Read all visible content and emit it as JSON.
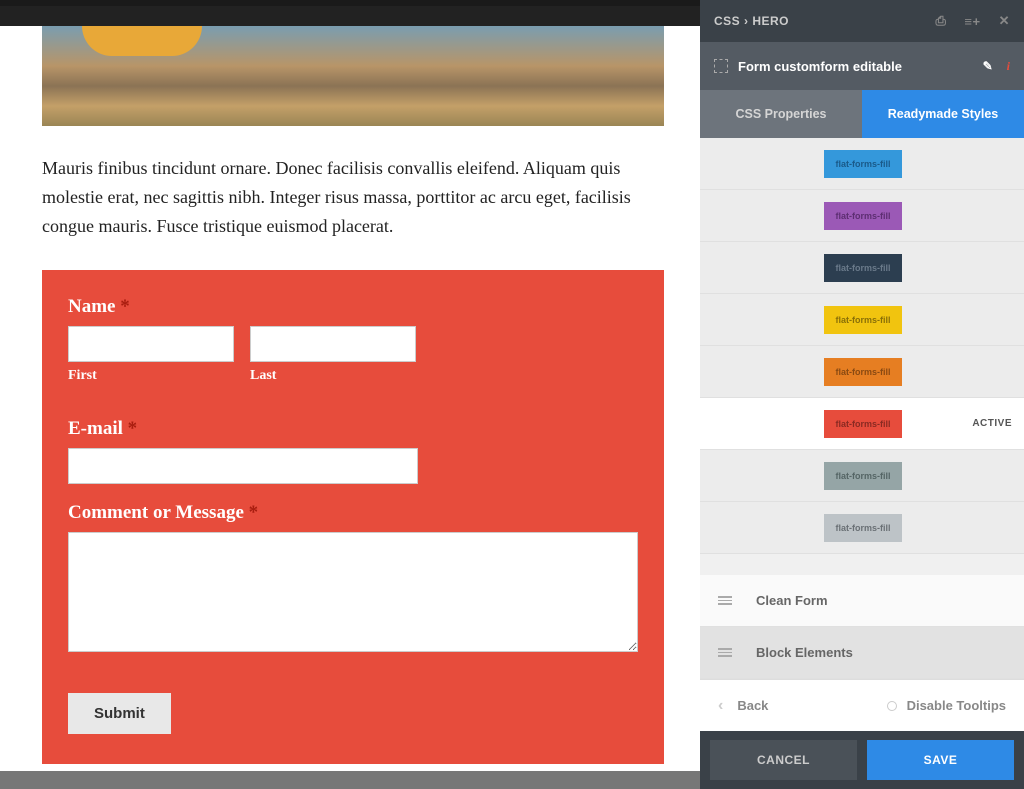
{
  "page": {
    "body_text": "Mauris finibus tincidunt ornare. Donec facilisis convallis eleifend. Aliquam quis molestie erat, nec sagittis nibh. Integer risus massa, porttitor ac arcu eget, facilisis congue mauris. Fusce tristique euismod placerat."
  },
  "form": {
    "name_label": "Name",
    "first_label": "First",
    "last_label": "Last",
    "email_label": "E-mail",
    "message_label": "Comment or Message",
    "required_mark": "*",
    "submit_label": "Submit"
  },
  "panel": {
    "brand": "CSS › HERO",
    "selector": "Form customform editable",
    "tabs": {
      "css": "CSS Properties",
      "ready": "Readymade Styles"
    },
    "styles": [
      {
        "label": "flat-forms-fill",
        "class": "sw-blue",
        "active": false
      },
      {
        "label": "flat-forms-fill",
        "class": "sw-purple",
        "active": false
      },
      {
        "label": "flat-forms-fill",
        "class": "sw-navy",
        "active": false
      },
      {
        "label": "flat-forms-fill",
        "class": "sw-yellow",
        "active": false
      },
      {
        "label": "flat-forms-fill",
        "class": "sw-orange",
        "active": false
      },
      {
        "label": "flat-forms-fill",
        "class": "sw-red",
        "active": true
      },
      {
        "label": "flat-forms-fill",
        "class": "sw-grey",
        "active": false
      },
      {
        "label": "flat-forms-fill",
        "class": "sw-light",
        "active": false
      }
    ],
    "active_text": "ACTIVE",
    "sections": {
      "clean": "Clean Form",
      "block": "Block Elements"
    },
    "back": "Back",
    "tooltips": "Disable Tooltips",
    "cancel": "CANCEL",
    "save": "SAVE"
  }
}
